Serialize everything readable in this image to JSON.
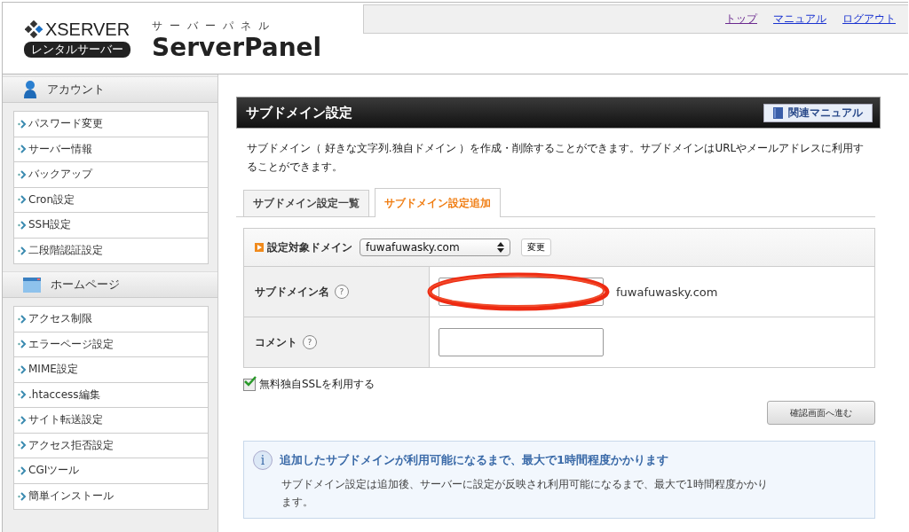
{
  "header": {
    "brand": "XSERVER",
    "brand_badge": "レンタルサーバー",
    "subtitle": "サーバーパネル",
    "title": "ServerPanel",
    "links": [
      {
        "label": "トップ",
        "visited": true
      },
      {
        "label": "マニュアル",
        "visited": false
      },
      {
        "label": "ログアウト",
        "visited": false
      }
    ]
  },
  "sidebar": {
    "sections": [
      {
        "title": "アカウント",
        "kind": "account",
        "items": [
          "パスワード変更",
          "サーバー情報",
          "バックアップ",
          "Cron設定",
          "SSH設定",
          "二段階認証設定"
        ]
      },
      {
        "title": "ホームページ",
        "kind": "homepage",
        "items": [
          "アクセス制限",
          "エラーページ設定",
          "MIME設定",
          ".htaccess編集",
          "サイト転送設定",
          "アクセス拒否設定",
          "CGIツール",
          "簡単インストール"
        ]
      }
    ]
  },
  "page": {
    "title": "サブドメイン設定",
    "manual_button": "関連マニュアル",
    "description": "サブドメイン（ 好きな文字列.独自ドメイン ）を作成・削除することができます。サブドメインはURLやメールアドレスに利用することができます。",
    "tabs": [
      {
        "label": "サブドメイン設定一覧",
        "selected": false
      },
      {
        "label": "サブドメイン設定追加",
        "selected": true
      }
    ],
    "domain_select": {
      "label": "設定対象ドメイン",
      "value": "fuwafuwasky.com",
      "button": "変更"
    },
    "form_rows": [
      {
        "label": "サブドメイン名",
        "help": "?",
        "suffix": "fuwafuwasky.com",
        "redacted": true
      },
      {
        "label": "コメント",
        "help": "?",
        "redacted": false
      }
    ],
    "ssl_checkbox": {
      "label": "無料独自SSLを利用する",
      "checked": true
    },
    "submit_button": "確認画面へ進む",
    "notice": {
      "icon": "i",
      "title": "追加したサブドメインが利用可能になるまで、最大で1時間程度かかります",
      "body": "サブドメイン設定は追加後、サーバーに設定が反映され利用可能になるまで、最大で1時間程度かかります。"
    }
  }
}
